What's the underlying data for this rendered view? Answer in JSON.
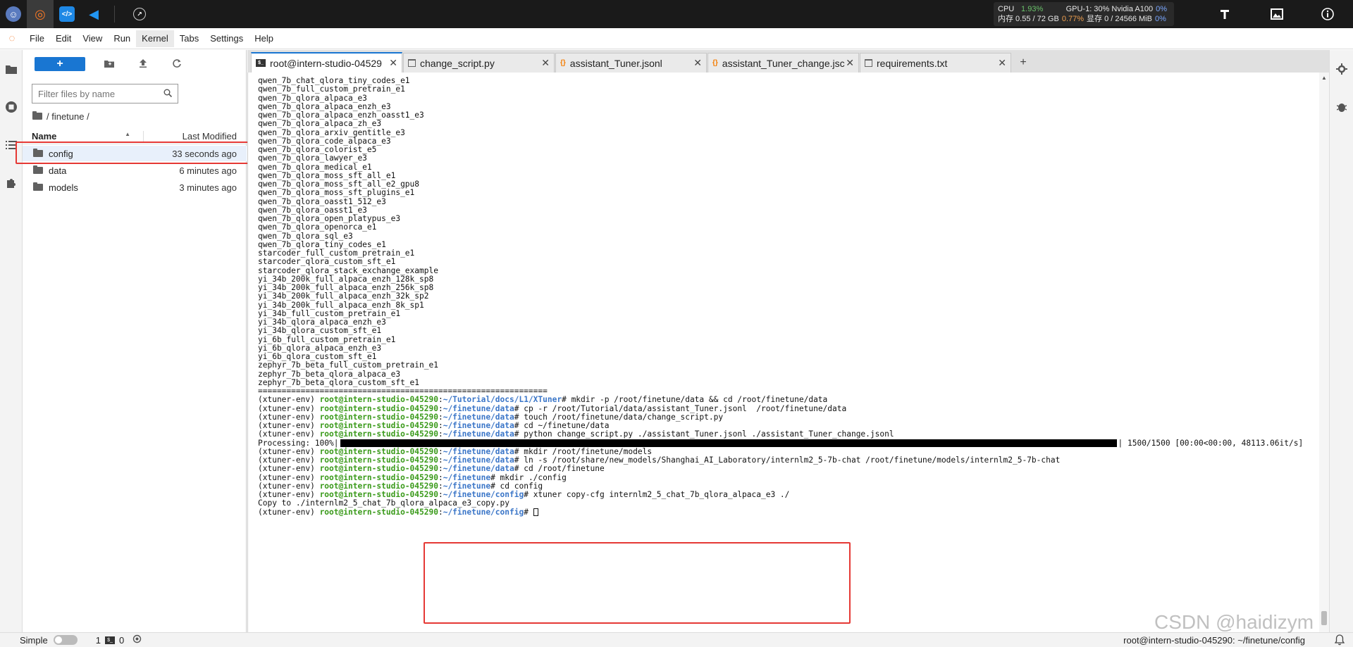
{
  "topbar": {
    "apps": [
      {
        "icon": "mascot-icon"
      },
      {
        "icon": "jupyter-icon"
      },
      {
        "icon": "code-icon"
      },
      {
        "icon": "vscode-icon"
      }
    ],
    "stats": {
      "cpu_label": "CPU",
      "cpu_value": "1.93%",
      "gpu_label": "GPU-1: 30% Nvidia A100",
      "gpu_value": "0%",
      "mem_label": "内存 0.55 / 72 GB",
      "mem_value": "0.77%",
      "vram_label": "显存 0 / 24566 MiB",
      "vram_value": "0%"
    }
  },
  "menu": {
    "items": [
      "File",
      "Edit",
      "View",
      "Run",
      "Kernel",
      "Tabs",
      "Settings",
      "Help"
    ],
    "highlighted": "Kernel"
  },
  "filebrowser": {
    "new_button": "+",
    "filter_placeholder": "Filter files by name",
    "breadcrumb": "/ finetune /",
    "col_name": "Name",
    "col_modified": "Last Modified",
    "files": [
      {
        "name": "config",
        "modified": "33 seconds ago",
        "type": "folder",
        "selected": true
      },
      {
        "name": "data",
        "modified": "6 minutes ago",
        "type": "folder",
        "selected": false
      },
      {
        "name": "models",
        "modified": "3 minutes ago",
        "type": "folder",
        "selected": false
      }
    ]
  },
  "tabs": [
    {
      "label": "root@intern-studio-04529",
      "icon": "terminal",
      "active": true
    },
    {
      "label": "change_script.py",
      "icon": "file",
      "active": false
    },
    {
      "label": "assistant_Tuner.jsonl",
      "icon": "json",
      "active": false
    },
    {
      "label": "assistant_Tuner_change.jsc",
      "icon": "json",
      "active": false
    },
    {
      "label": "requirements.txt",
      "icon": "file",
      "active": false
    }
  ],
  "terminal": {
    "config_list": [
      "qwen_7b_chat_qlora_tiny_codes_e1",
      "qwen_7b_full_custom_pretrain_e1",
      "qwen_7b_qlora_alpaca_e3",
      "qwen_7b_qlora_alpaca_enzh_e3",
      "qwen_7b_qlora_alpaca_enzh_oasst1_e3",
      "qwen_7b_qlora_alpaca_zh_e3",
      "qwen_7b_qlora_arxiv_gentitle_e3",
      "qwen_7b_qlora_code_alpaca_e3",
      "qwen_7b_qlora_colorist_e5",
      "qwen_7b_qlora_lawyer_e3",
      "qwen_7b_qlora_medical_e1",
      "qwen_7b_qlora_moss_sft_all_e1",
      "qwen_7b_qlora_moss_sft_all_e2_gpu8",
      "qwen_7b_qlora_moss_sft_plugins_e1",
      "qwen_7b_qlora_oasst1_512_e3",
      "qwen_7b_qlora_oasst1_e3",
      "qwen_7b_qlora_open_platypus_e3",
      "qwen_7b_qlora_openorca_e1",
      "qwen_7b_qlora_sql_e3",
      "qwen_7b_qlora_tiny_codes_e1",
      "starcoder_full_custom_pretrain_e1",
      "starcoder_qlora_custom_sft_e1",
      "starcoder_qlora_stack_exchange_example",
      "yi_34b_200k_full_alpaca_enzh_128k_sp8",
      "yi_34b_200k_full_alpaca_enzh_256k_sp8",
      "yi_34b_200k_full_alpaca_enzh_32k_sp2",
      "yi_34b_200k_full_alpaca_enzh_8k_sp1",
      "yi_34b_full_custom_pretrain_e1",
      "yi_34b_qlora_alpaca_enzh_e3",
      "yi_34b_qlora_custom_sft_e1",
      "yi_6b_full_custom_pretrain_e1",
      "yi_6b_qlora_alpaca_enzh_e3",
      "yi_6b_qlora_custom_sft_e1",
      "zephyr_7b_beta_full_custom_pretrain_e1",
      "zephyr_7b_beta_qlora_alpaca_e3",
      "zephyr_7b_beta_qlora_custom_sft_e1"
    ],
    "divider": "=============================================================",
    "env": "(xtuner-env)",
    "host": "root@intern-studio-045290",
    "commands": [
      {
        "path": "~/Tutorial/docs/L1/XTuner",
        "cmd": "mkdir -p /root/finetune/data && cd /root/finetune/data"
      },
      {
        "path": "~/finetune/data",
        "cmd": "cp -r /root/Tutorial/data/assistant_Tuner.jsonl  /root/finetune/data"
      },
      {
        "path": "~/finetune/data",
        "cmd": "touch /root/finetune/data/change_script.py"
      },
      {
        "path": "~/finetune/data",
        "cmd": "cd ~/finetune/data"
      },
      {
        "path": "~/finetune/data",
        "cmd": "python change_script.py ./assistant_Tuner.jsonl ./assistant_Tuner_change.jsonl"
      }
    ],
    "progress": {
      "label": "Processing: 100%|",
      "fraction": 1.0,
      "tail": "| 1500/1500 [00:00<00:00, 48113.06it/s]"
    },
    "commands2": [
      {
        "path": "~/finetune/data",
        "cmd": "mkdir /root/finetune/models"
      },
      {
        "path": "~/finetune/data",
        "cmd": "ln -s /root/share/new_models/Shanghai_AI_Laboratory/internlm2_5-7b-chat /root/finetune/models/internlm2_5-7b-chat"
      },
      {
        "path": "~/finetune/data",
        "cmd": "cd /root/finetune"
      },
      {
        "path": "~/finetune",
        "cmd": "mkdir ./config"
      },
      {
        "path": "~/finetune",
        "cmd": "cd config"
      },
      {
        "path": "~/finetune/config",
        "cmd": "xtuner copy-cfg internlm2_5_chat_7b_qlora_alpaca_e3 ./"
      }
    ],
    "output": "Copy to ./internlm2_5_chat_7b_qlora_alpaca_e3_copy.py",
    "final_path": "~/finetune/config"
  },
  "statusbar": {
    "mode": "Simple",
    "kernels": "1",
    "terminals": "0",
    "right_text": "root@intern-studio-045290: ~/finetune/config"
  },
  "watermark": "CSDN @haidizym",
  "colors": {
    "accent": "#1976d2",
    "highlight_box": "#e53935",
    "prompt_host": "#3a9a1a",
    "prompt_path": "#3b76c8"
  }
}
